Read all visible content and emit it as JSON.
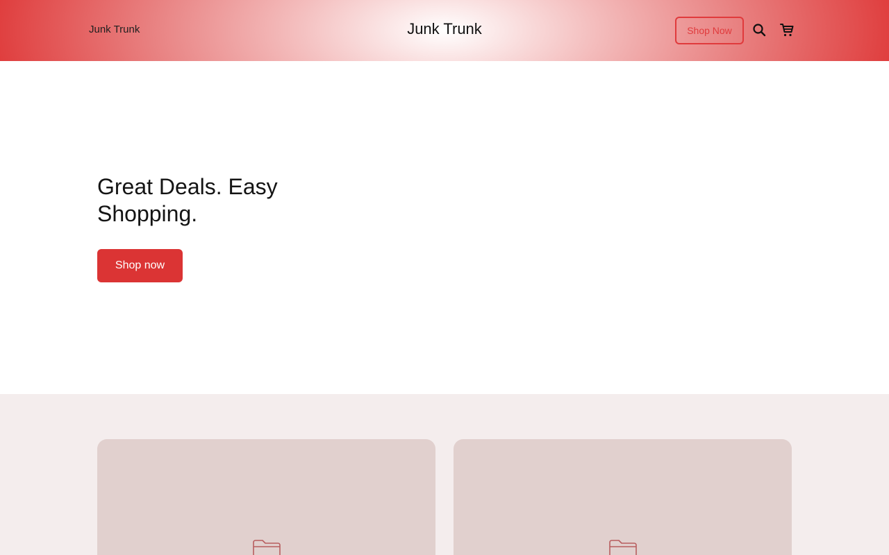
{
  "header": {
    "brand_left": "Junk Trunk",
    "brand_center": "Junk Trunk",
    "shop_button_label": "Shop Now",
    "search_icon": "search-icon",
    "cart_icon": "cart-icon"
  },
  "hero": {
    "title": "Great Deals. Easy Shopping.",
    "cta_label": "Shop now"
  },
  "collections": {
    "cards": [
      {
        "icon": "folder-icon"
      },
      {
        "icon": "folder-icon"
      }
    ]
  },
  "colors": {
    "accent": "#db3434",
    "header_edge": "#df3a3a",
    "section_bg": "#f4eded",
    "card_bg": "#e1d0ce"
  }
}
